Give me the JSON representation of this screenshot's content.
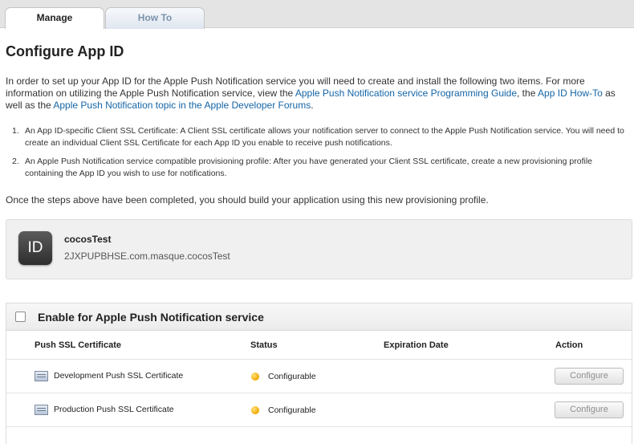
{
  "tabs": [
    {
      "label": "Manage",
      "active": true
    },
    {
      "label": "How To",
      "active": false
    }
  ],
  "page_title": "Configure App ID",
  "intro": {
    "text1": "In order to set up your App ID for the Apple Push Notification service you will need to create and install the following two items. For more information on utilizing the Apple Push Notification service, view the ",
    "link1": "Apple Push Notification service Programming Guide",
    "text2": ", the ",
    "link2": "App ID How-To",
    "text3": " as well as the ",
    "link3": "Apple Push Notification topic in the Apple Developer Forums",
    "text4": "."
  },
  "steps": [
    {
      "num": "1.",
      "text": "An App ID-specific Client SSL Certificate: A Client SSL certificate allows your notification server to connect to the Apple Push Notification service. You will need to create an individual Client SSL Certificate for each App ID you enable to receive push notifications."
    },
    {
      "num": "2.",
      "text": "An Apple Push Notification service compatible provisioning profile: After you have generated your Client SSL certificate, create a new provisioning profile containing the App ID you wish to use for notifications."
    }
  ],
  "outro": "Once the steps above have been completed, you should build your application using this new provisioning profile.",
  "app": {
    "icon_label": "ID",
    "name": "cocosTest",
    "bundle_id": "2JXPUPBHSE.com.masque.cocosTest"
  },
  "push": {
    "enable_label": "Enable for Apple Push Notification service",
    "enabled": false,
    "columns": {
      "cert": "Push SSL Certificate",
      "status": "Status",
      "expiration": "Expiration Date",
      "action": "Action"
    },
    "rows": [
      {
        "name": "Development Push SSL Certificate",
        "status": "Configurable",
        "expiration": "",
        "action": "Configure",
        "status_color": "#f0a800"
      },
      {
        "name": "Production Push SSL Certificate",
        "status": "Configurable",
        "expiration": "",
        "action": "Configure",
        "status_color": "#f0a800"
      }
    ]
  },
  "colors": {
    "link": "#1565a6",
    "status_pending": "#f0a800"
  }
}
